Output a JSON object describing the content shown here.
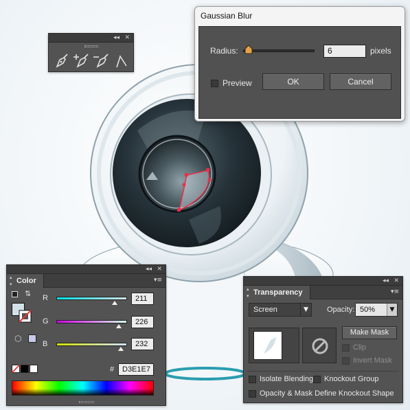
{
  "gaussian_blur": {
    "title": "Gaussian Blur",
    "radius_label": "Radius:",
    "radius_value": "6",
    "radius_unit": "pixels",
    "radius_slider_fraction": 0.08,
    "preview_label": "Preview",
    "preview_checked": false,
    "ok_label": "OK",
    "cancel_label": "Cancel"
  },
  "pen_tools": {
    "collapse_icon": "double-chevron-left-icon",
    "close_icon": "close-icon",
    "tools": [
      "pen-icon",
      "add-anchor-point-icon",
      "delete-anchor-point-icon",
      "convert-anchor-point-icon"
    ]
  },
  "color_panel": {
    "tab_label": "Color",
    "channels": [
      {
        "label": "R",
        "value": "211",
        "fraction": 0.827
      },
      {
        "label": "G",
        "value": "226",
        "fraction": 0.886
      },
      {
        "label": "B",
        "value": "232",
        "fraction": 0.91
      }
    ],
    "hex_label": "#",
    "hex_value": "D3E1E7",
    "fill_color": "#D3E1E7",
    "outofweb_swatch_color": "#C8C8E8"
  },
  "transparency_panel": {
    "tab_label": "Transparency",
    "blend_mode": "Screen",
    "opacity_label": "Opacity:",
    "opacity_value": "50%",
    "make_mask_label": "Make Mask",
    "clip_label": "Clip",
    "invert_mask_label": "Invert Mask",
    "isolate_blending_label": "Isolate Blending",
    "knockout_group_label": "Knockout Group",
    "opacity_mask_label": "Opacity & Mask Define Knockout Shape"
  },
  "colors": {
    "panel_bg": "#535353",
    "cam_body": "#F5F8FA",
    "cam_ring": "#2E3B40",
    "accent_teal": "#2A9DB0",
    "selection_red": "#E8304A"
  }
}
